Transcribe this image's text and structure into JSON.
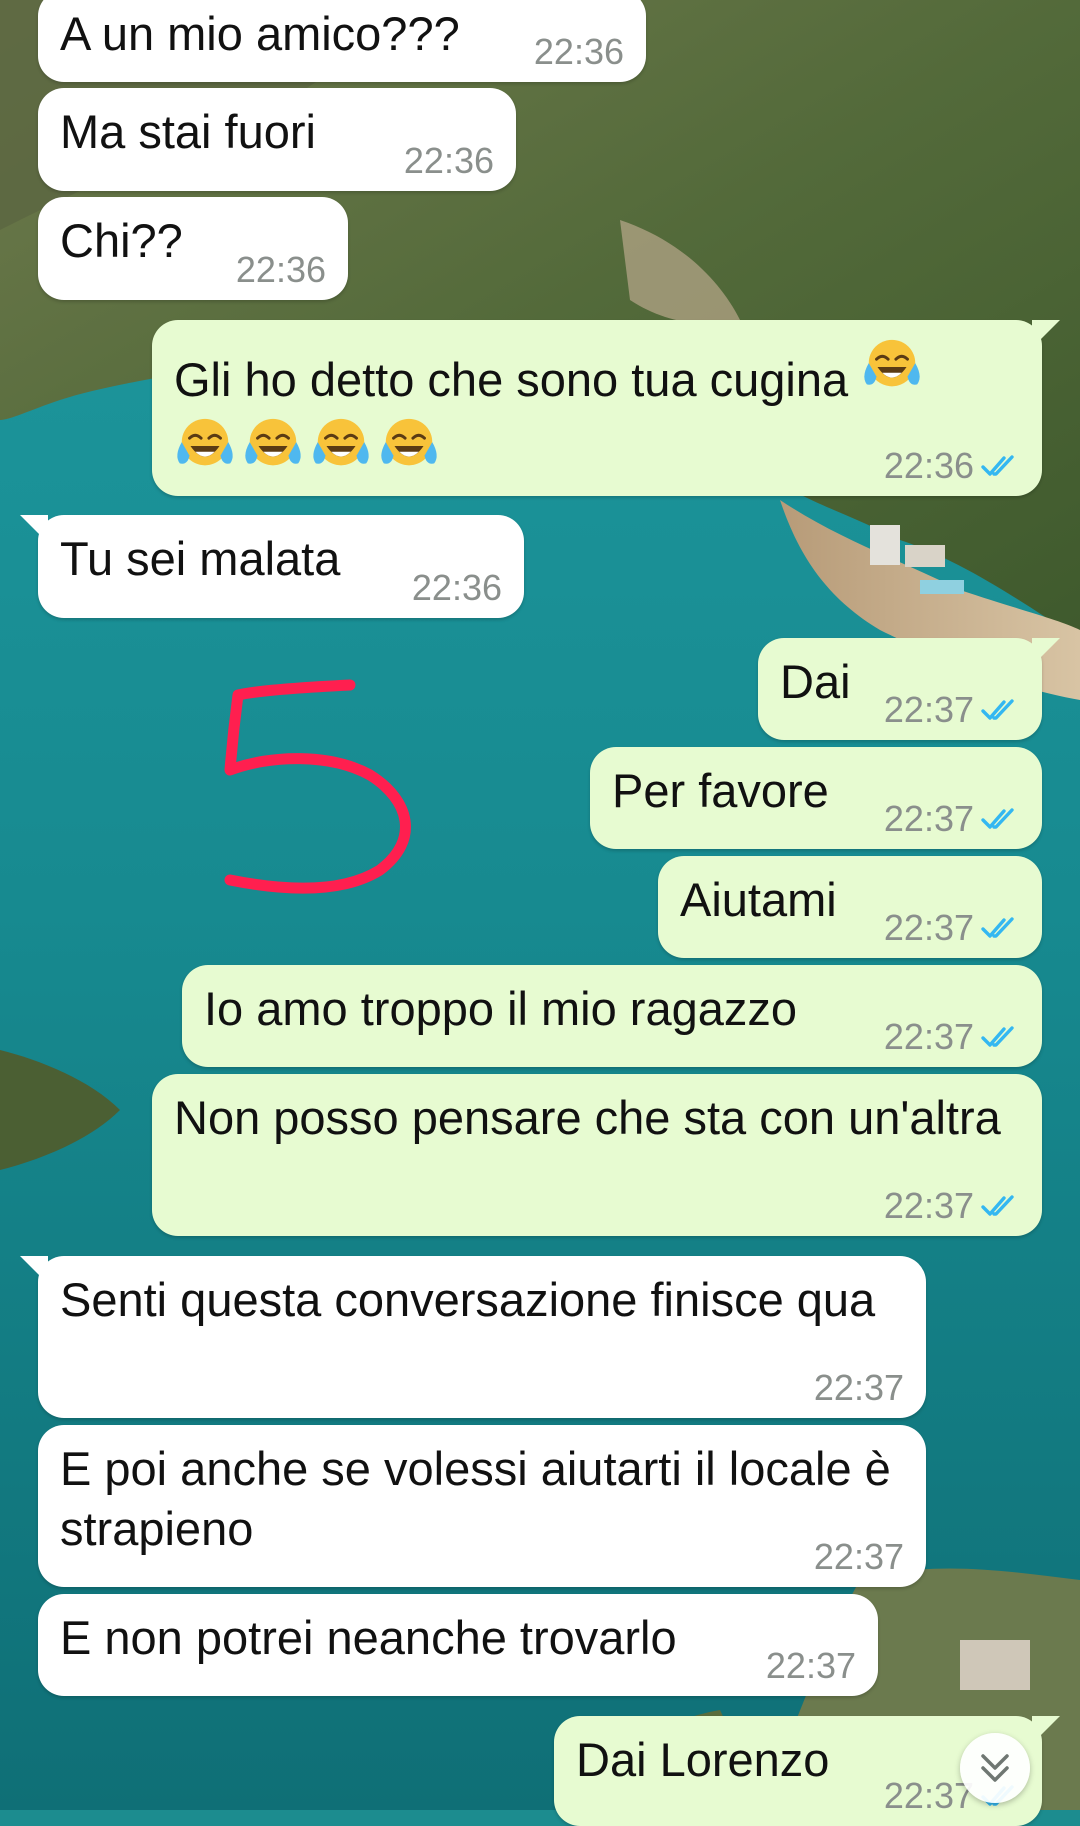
{
  "colors": {
    "incoming_bubble": "#ffffff",
    "outgoing_bubble": "#e7fbd1",
    "read_ticks": "#34b7f1",
    "annotation": "#ff1f4f"
  },
  "annotation": {
    "icon": "hand-drawn-number",
    "text": "5"
  },
  "emoji_icon": "face-with-tears-of-joy",
  "messages": [
    {
      "dir": "in",
      "text": "A un mio amico???",
      "time": "22:36"
    },
    {
      "dir": "in",
      "text": "Ma stai fuori",
      "time": "22:36"
    },
    {
      "dir": "in",
      "text": "Chi??",
      "time": "22:36"
    },
    {
      "dir": "out",
      "text": "Gli ho detto che sono tua cugina",
      "time": "22:36",
      "status": "read"
    },
    {
      "dir": "in",
      "text": "Tu sei malata",
      "time": "22:36"
    },
    {
      "dir": "out",
      "text": "Dai",
      "time": "22:37",
      "status": "read"
    },
    {
      "dir": "out",
      "text": "Per favore",
      "time": "22:37",
      "status": "read"
    },
    {
      "dir": "out",
      "text": "Aiutami",
      "time": "22:37",
      "status": "read"
    },
    {
      "dir": "out",
      "text": "Io amo troppo il mio ragazzo",
      "time": "22:37",
      "status": "read"
    },
    {
      "dir": "out",
      "text": "Non posso pensare che sta con un'altra",
      "time": "22:37",
      "status": "read"
    },
    {
      "dir": "in",
      "text": "Senti questa conversazione finisce qua",
      "time": "22:37"
    },
    {
      "dir": "in",
      "text": "E poi anche se volessi aiutarti il locale è strapieno",
      "time": "22:37"
    },
    {
      "dir": "in",
      "text": "E non potrei neanche trovarlo",
      "time": "22:37"
    },
    {
      "dir": "out",
      "text": "Dai Lorenzo",
      "time": "22:37",
      "status": "read"
    }
  ],
  "scroll_button_icon": "double-chevron-down-icon"
}
